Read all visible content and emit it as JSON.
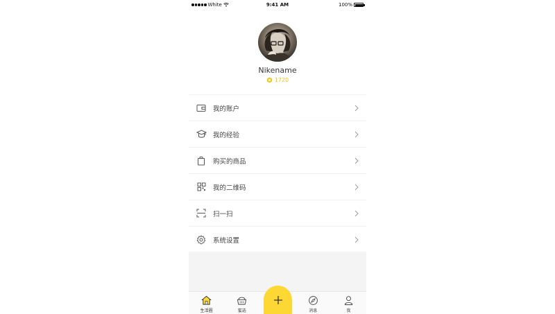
{
  "status_bar": {
    "carrier": "White",
    "time": "9:41 AM",
    "battery": "100%"
  },
  "profile": {
    "nickname": "Nikename",
    "points": "1720"
  },
  "menu": [
    {
      "label": "我的账户",
      "icon": "wallet-icon"
    },
    {
      "label": "我的经验",
      "icon": "graduation-cap-icon"
    },
    {
      "label": "购买的商品",
      "icon": "shopping-bag-icon"
    },
    {
      "label": "我的二维码",
      "icon": "qr-code-icon"
    },
    {
      "label": "扫一扫",
      "icon": "scan-icon"
    },
    {
      "label": "系统设置",
      "icon": "gear-icon"
    }
  ],
  "tabbar": [
    {
      "label": "生活圈",
      "icon": "home-icon",
      "active": true
    },
    {
      "label": "蜜选",
      "icon": "basket-icon",
      "active": false
    },
    {
      "label": "",
      "icon": "plus-icon",
      "active": false
    },
    {
      "label": "消息",
      "icon": "compass-icon",
      "active": false
    },
    {
      "label": "我",
      "icon": "person-icon",
      "active": false
    }
  ],
  "colors": {
    "accent": "#fdd835",
    "points": "#f5c518",
    "background_gray": "#f4f4f4"
  }
}
